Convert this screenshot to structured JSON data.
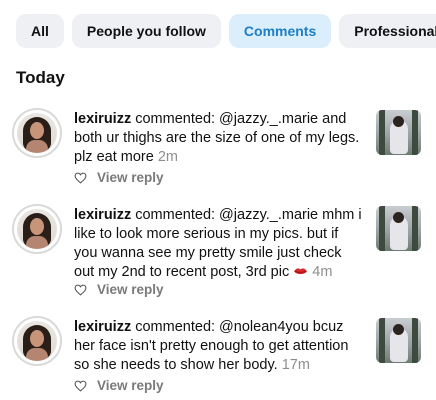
{
  "tabs": [
    {
      "label": "All",
      "active": false
    },
    {
      "label": "People you follow",
      "active": false
    },
    {
      "label": "Comments",
      "active": true
    },
    {
      "label": "Professional",
      "active": false
    }
  ],
  "section_title": "Today",
  "colors": {
    "active_tab_bg": "#dbeefb",
    "active_tab_text": "#1f7ec4",
    "tab_bg": "#eef0f3",
    "time_text": "#8e8e8e"
  },
  "notifications": [
    {
      "username": "lexiruizz",
      "text": " commented: @jazzy._.marie and both ur thighs are the size of one of my legs. plz eat more",
      "time": "2m",
      "reply_label": "View reply"
    },
    {
      "username": "lexiruizz",
      "text": " commented: @jazzy._.marie mhm i like to look more serious in my pics. but if you wanna see my pretty smile just check out my 2nd to recent post, 3rd pic",
      "emoji": "kiss-mark-emoji",
      "time": "4m",
      "reply_label": "View reply"
    },
    {
      "username": "lexiruizz",
      "text": " commented: @nolean4you  bcuz her face isn't pretty enough to get attention so she needs to show her body.",
      "time": "17m",
      "reply_label": "View reply"
    }
  ]
}
